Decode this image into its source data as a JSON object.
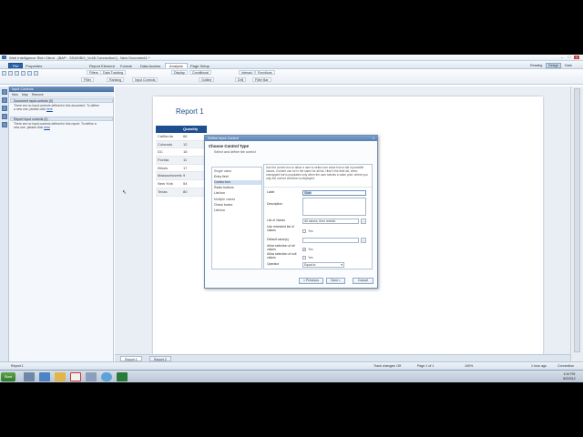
{
  "window": {
    "title": "Web Intelligence Rich Client - [BAP - SSAS/BO_Vc46 Connection\\] - New Document1 *"
  },
  "menu_tabs": [
    "File",
    "Properties",
    "Report Element",
    "Format",
    "Data Access",
    "Analysis",
    "Page Setup"
  ],
  "active_menu_tab": "Analysis",
  "toolbar": {
    "subtabs": [
      "Filters",
      "Data Tracking",
      "Display",
      "Conditional",
      "Interact",
      "Functions"
    ],
    "buttons": [
      "Filter",
      "Ranking",
      "Input Controls",
      "Outline",
      "Drill",
      "Filter Bar"
    ],
    "right": {
      "reading": "Reading",
      "design": "Design",
      "data": "Data"
    }
  },
  "left_panel": {
    "header": "Input Controls",
    "toolbar": [
      "New",
      "Map",
      "Remove"
    ],
    "doc_section": "Document input controls (0)",
    "doc_text_1": "There are no input controls defined in this document. To define",
    "doc_text_2": "a new one, please click",
    "report_section": "Report input controls (0)",
    "report_text_1": "There are no input controls defined in this report. To define a",
    "report_text_2": "new one, please click",
    "link": "here"
  },
  "report": {
    "title": "Report 1",
    "columns": [
      "State",
      "Quantity sold"
    ],
    "rows": [
      [
        "California",
        "66"
      ],
      [
        "Colorado",
        "12"
      ],
      [
        "DC",
        "16"
      ],
      [
        "Florida",
        "11"
      ],
      [
        "Illinois",
        "17"
      ],
      [
        "Massachusetts",
        "9"
      ],
      [
        "New York",
        "54"
      ],
      [
        "Texas",
        "80"
      ]
    ]
  },
  "doc_tabs": [
    "Report 1",
    "Report 2"
  ],
  "status": {
    "left": "Report 1",
    "track_changes": "Track changes: Off",
    "page": "Page 1 of 1",
    "zoom": "100%",
    "time_ago": "1 hour ago",
    "connection": "Connection"
  },
  "dialog": {
    "title": "Define Input Control",
    "heading": "Choose Control Type",
    "subheading": "Select and define the control",
    "list": {
      "single_group": "Single value",
      "single_items": [
        "Entry field",
        "Combo box",
        "Radio buttons",
        "List box"
      ],
      "multiple_group": "Multiple values",
      "multiple_items": [
        "Check boxes",
        "List box"
      ],
      "selected": "Combo box"
    },
    "description": "Use the combo box to allow a user to select one value from a list of possible values. Content can be in the same for all list, Hide it the field list, when unmapped but is populated only when the user selects a value prior, where you only the current selection is displayed.",
    "fields": {
      "label_lbl": "Label",
      "label_val": "State",
      "description_lbl": "Description",
      "lov_lbl": "List of Values",
      "lov_val": "All values, then restrict",
      "use_restricted_lbl": "Use restricted list of values",
      "use_restricted_opt": "Yes",
      "default_lbl": "Default value(s)",
      "allow_all_lbl": "Allow selection of all values",
      "allow_all_opt": "Yes",
      "allow_null_lbl": "Allow selection of null values",
      "allow_null_opt": "Yes",
      "operator_lbl": "Operator",
      "operator_val": "Equal to"
    },
    "buttons": {
      "previous": "< Previous",
      "next": "Next >",
      "cancel": "Cancel"
    }
  },
  "taskbar": {
    "start": "Start",
    "time": "4:10 PM",
    "date": "8/2/2012"
  }
}
